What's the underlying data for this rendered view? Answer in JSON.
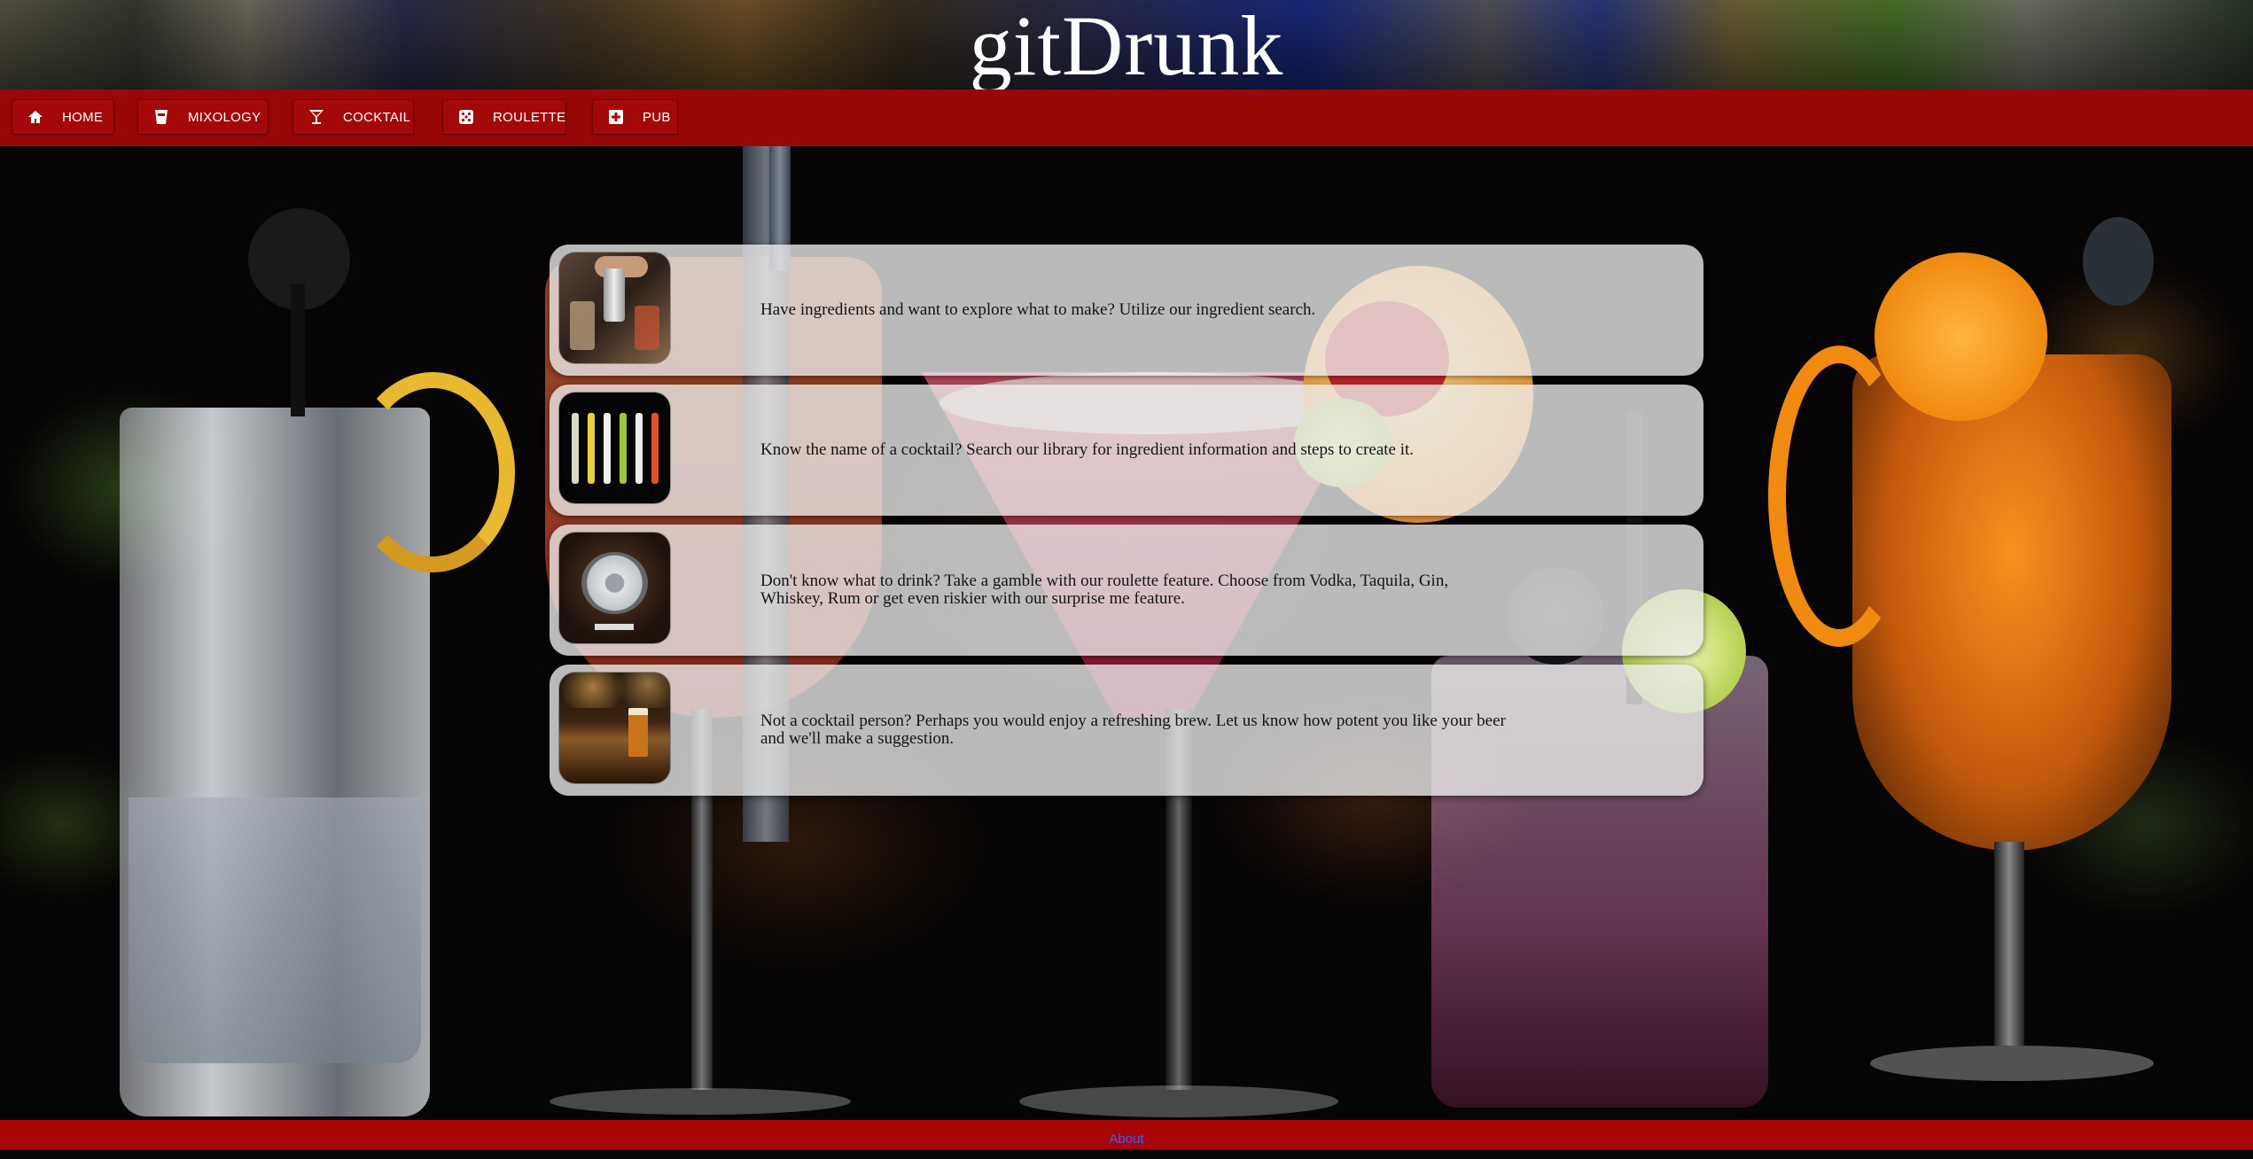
{
  "header": {
    "title": "gitDrunk"
  },
  "nav": {
    "items": [
      {
        "label": "HOME",
        "icon": "home-icon"
      },
      {
        "label": "MIXOLOGY",
        "icon": "cup-icon"
      },
      {
        "label": "COCKTAIL",
        "icon": "cocktail-glass-icon"
      },
      {
        "label": "ROULETTE",
        "icon": "dice-icon"
      },
      {
        "label": "PUB",
        "icon": "plus-square-icon"
      }
    ]
  },
  "cards": [
    {
      "text": "Have ingredients and want to explore what to make? Utilize our ingredient search."
    },
    {
      "text": "Know the name of a cocktail? Search our library for ingredient information and steps to create it."
    },
    {
      "text": "Don't know what to drink? Take a gamble with our roulette feature. Choose from Vodka, Taquila, Gin, Whiskey, Rum or get even riskier with our surprise me feature."
    },
    {
      "text": "Not a cocktail person? Perhaps you would enjoy a refreshing brew. Let us know how potent you like your beer and we'll make a suggestion."
    }
  ],
  "footer": {
    "about_label": "About"
  },
  "colors": {
    "nav_background": "#9a0707",
    "footer_background": "#a80606",
    "card_background": "rgba(232,232,232,0.80)",
    "link": "#3a5cff"
  }
}
